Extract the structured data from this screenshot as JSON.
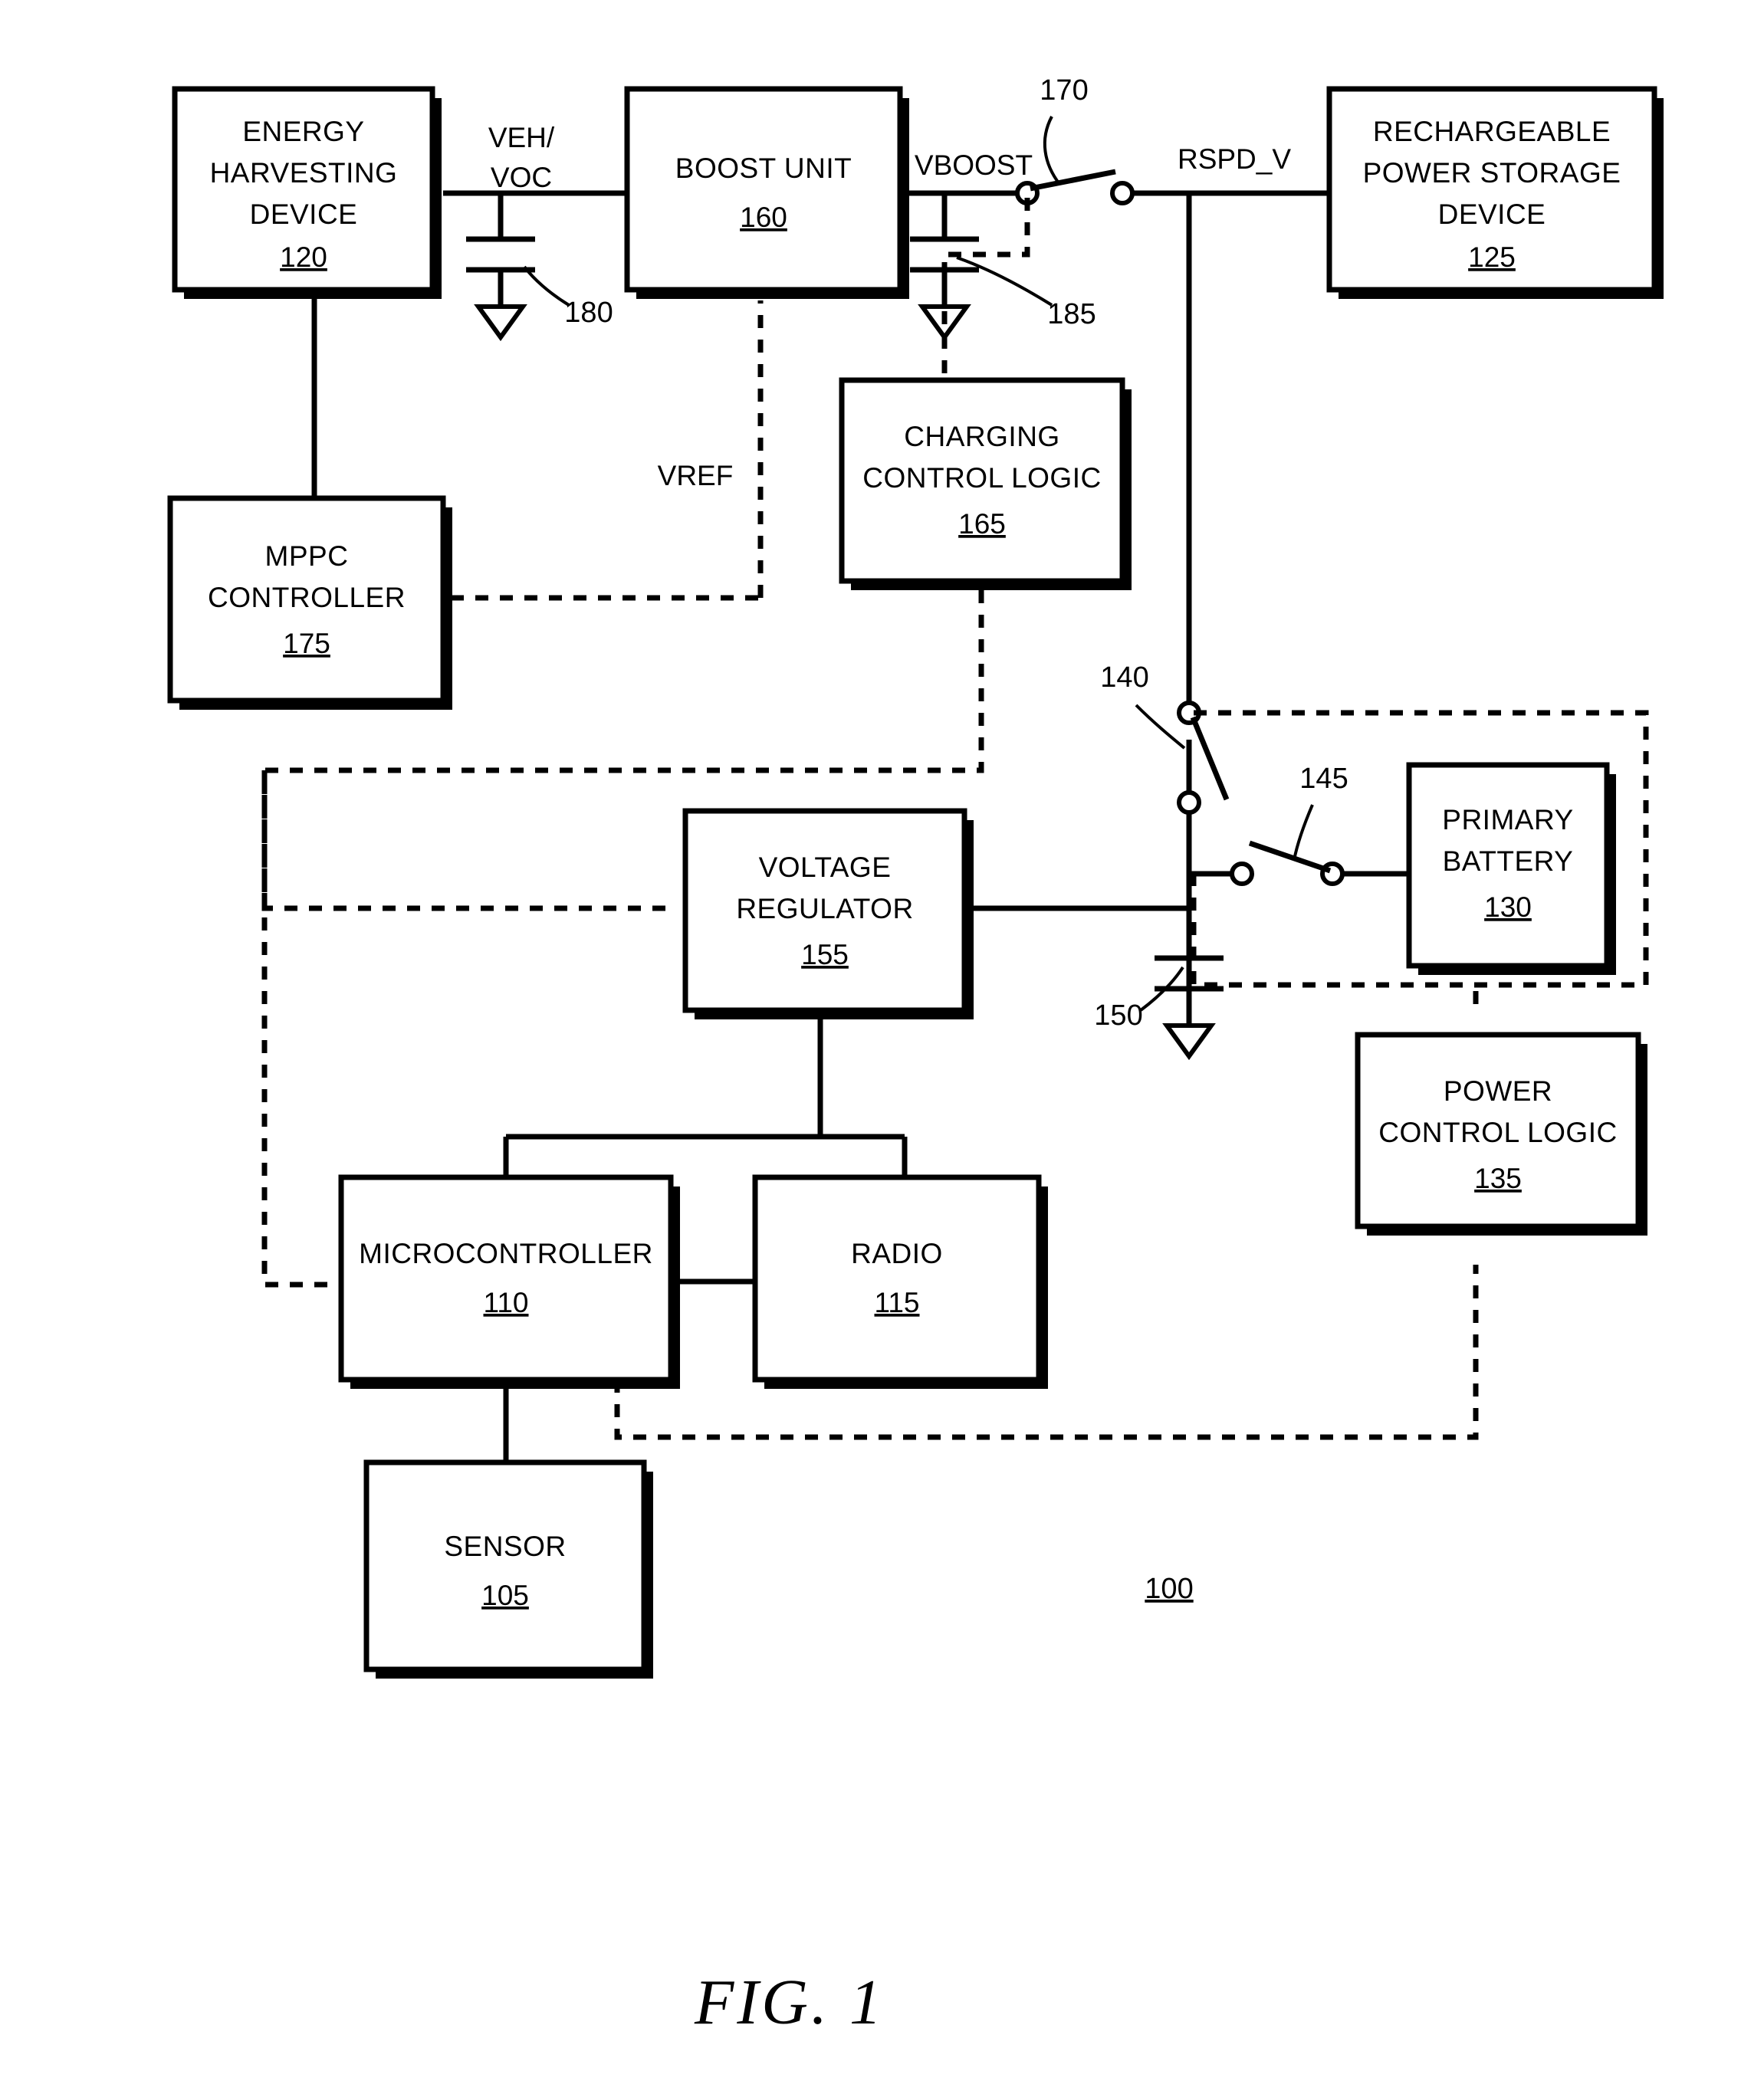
{
  "figure": {
    "caption": "FIG. 1",
    "system_ref": "100"
  },
  "boxes": [
    {
      "id": "energy-harvesting-device",
      "lines": [
        "ENERGY",
        "HARVESTING",
        "DEVICE"
      ],
      "ref": "120"
    },
    {
      "id": "boost-unit",
      "lines": [
        "BOOST UNIT"
      ],
      "ref": "160"
    },
    {
      "id": "rechargeable-power-storage-device",
      "lines": [
        "RECHARGEABLE",
        "POWER STORAGE",
        "DEVICE"
      ],
      "ref": "125"
    },
    {
      "id": "mppc-controller",
      "lines": [
        "MPPC",
        "CONTROLLER"
      ],
      "ref": "175"
    },
    {
      "id": "charging-control-logic",
      "lines": [
        "CHARGING",
        "CONTROL LOGIC"
      ],
      "ref": "165"
    },
    {
      "id": "primary-battery",
      "lines": [
        "PRIMARY",
        "BATTERY"
      ],
      "ref": "130"
    },
    {
      "id": "power-control-logic",
      "lines": [
        "POWER",
        "CONTROL LOGIC"
      ],
      "ref": "135"
    },
    {
      "id": "voltage-regulator",
      "lines": [
        "VOLTAGE",
        "REGULATOR"
      ],
      "ref": "155"
    },
    {
      "id": "microcontroller",
      "lines": [
        "MICROCONTROLLER"
      ],
      "ref": "110"
    },
    {
      "id": "radio",
      "lines": [
        "RADIO"
      ],
      "ref": "115"
    },
    {
      "id": "sensor",
      "lines": [
        "SENSOR"
      ],
      "ref": "105"
    }
  ],
  "signals": {
    "veh_voc_line1": "VEH/",
    "veh_voc_line2": "VOC",
    "vboost": "VBOOST",
    "rspd_v": "RSPD_V",
    "vref": "VREF"
  },
  "reference_numerals": {
    "switch_170": "170",
    "cap_180": "180",
    "link_185": "185",
    "switch_140": "140",
    "switch_145": "145",
    "cap_150": "150"
  },
  "colors": {
    "ink": "#000000",
    "paper": "#ffffff"
  }
}
